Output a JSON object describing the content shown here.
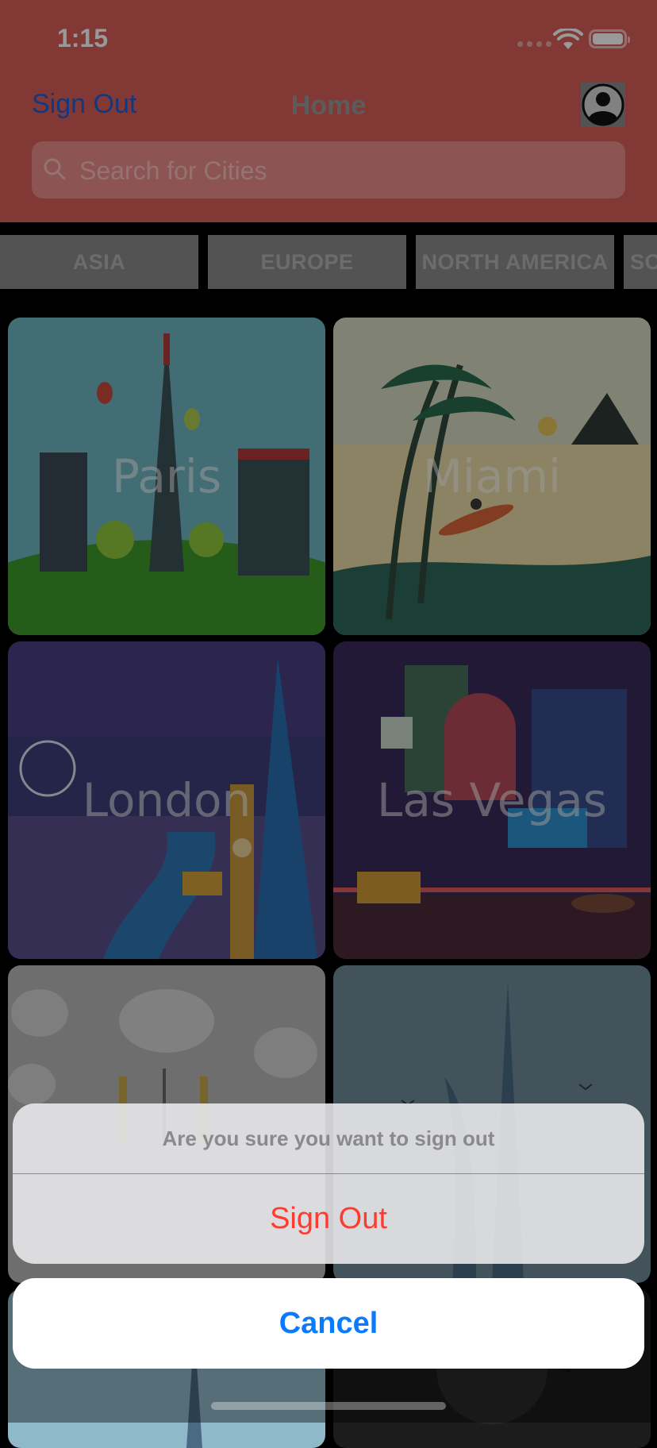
{
  "status_bar": {
    "time": "1:15"
  },
  "nav": {
    "sign_out_label": "Sign Out",
    "title": "Home",
    "avatar_icon": "person-circle-icon"
  },
  "search": {
    "placeholder": "Search for Cities"
  },
  "region_tabs": [
    "ASIA",
    "EUROPE",
    "NORTH AMERICA",
    "SOUTH AMERICA"
  ],
  "cities": [
    "Paris",
    "Miami",
    "London",
    "Las Vegas",
    "",
    ""
  ],
  "action_sheet": {
    "message": "Are you sure you want to sign out",
    "destructive_label": "Sign Out",
    "cancel_label": "Cancel"
  },
  "colors": {
    "header": "#d95f5a",
    "link": "#0a7aff",
    "destructive": "#ff3b30",
    "tab_bg": "#8a8a8a"
  }
}
